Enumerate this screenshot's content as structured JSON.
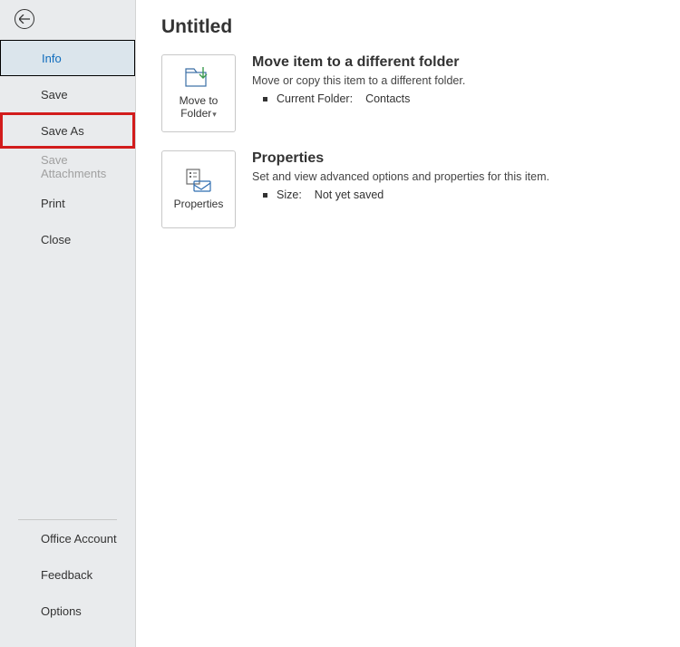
{
  "sidebar": {
    "top": [
      {
        "label": "Info",
        "state": "selected"
      },
      {
        "label": "Save",
        "state": "normal"
      },
      {
        "label": "Save As",
        "state": "highlight"
      },
      {
        "label": "Save Attachments",
        "state": "disabled"
      },
      {
        "label": "Print",
        "state": "normal"
      },
      {
        "label": "Close",
        "state": "normal"
      }
    ],
    "bottom": [
      {
        "label": "Office Account"
      },
      {
        "label": "Feedback"
      },
      {
        "label": "Options"
      }
    ]
  },
  "page_title": "Untitled",
  "sections": {
    "move": {
      "tile_line1": "Move to",
      "tile_line2": "Folder",
      "heading": "Move item to a different folder",
      "description": "Move or copy this item to a different folder.",
      "current_folder_key": "Current Folder:",
      "current_folder_val": "Contacts"
    },
    "properties": {
      "tile_label": "Properties",
      "heading": "Properties",
      "description": "Set and view advanced options and properties for this item.",
      "size_key": "Size:",
      "size_val": "Not yet saved"
    }
  }
}
